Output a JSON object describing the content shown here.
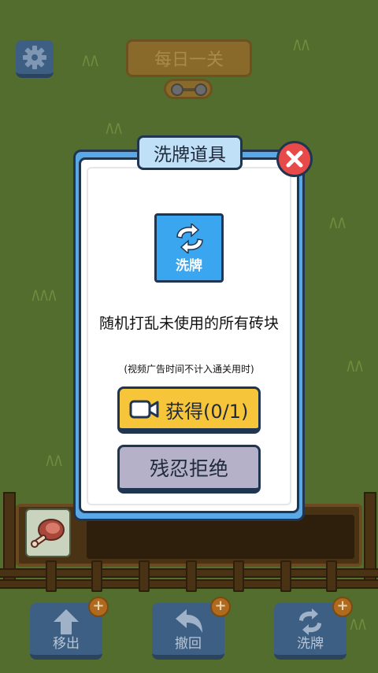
{
  "top": {
    "daily_label": "每日一关"
  },
  "dialog": {
    "title": "洗牌道具",
    "card_label": "洗牌",
    "description": "随机打乱未使用的所有砖块",
    "note": "(视频广告时间不计入通关用时)",
    "get_button": "获得(0/1)",
    "refuse_button": "残忍拒绝"
  },
  "tools": [
    {
      "label": "移出",
      "badge": "+"
    },
    {
      "label": "撤回",
      "badge": "+"
    },
    {
      "label": "洗牌",
      "badge": "+"
    }
  ],
  "colors": {
    "background": "#526d2d",
    "dialog_blue": "#5aa8e6",
    "get_button": "#f7c53a",
    "refuse_button": "#b4b1c8",
    "close_button": "#e84a4a",
    "tool_button": "#3d5f84"
  },
  "icons": {
    "settings": "gear-icon",
    "close": "close-icon",
    "shuffle": "shuffle-icon",
    "video": "video-camera-icon",
    "move_out": "arrow-up-icon",
    "undo": "undo-arrow-icon",
    "tile": "ham-icon"
  }
}
